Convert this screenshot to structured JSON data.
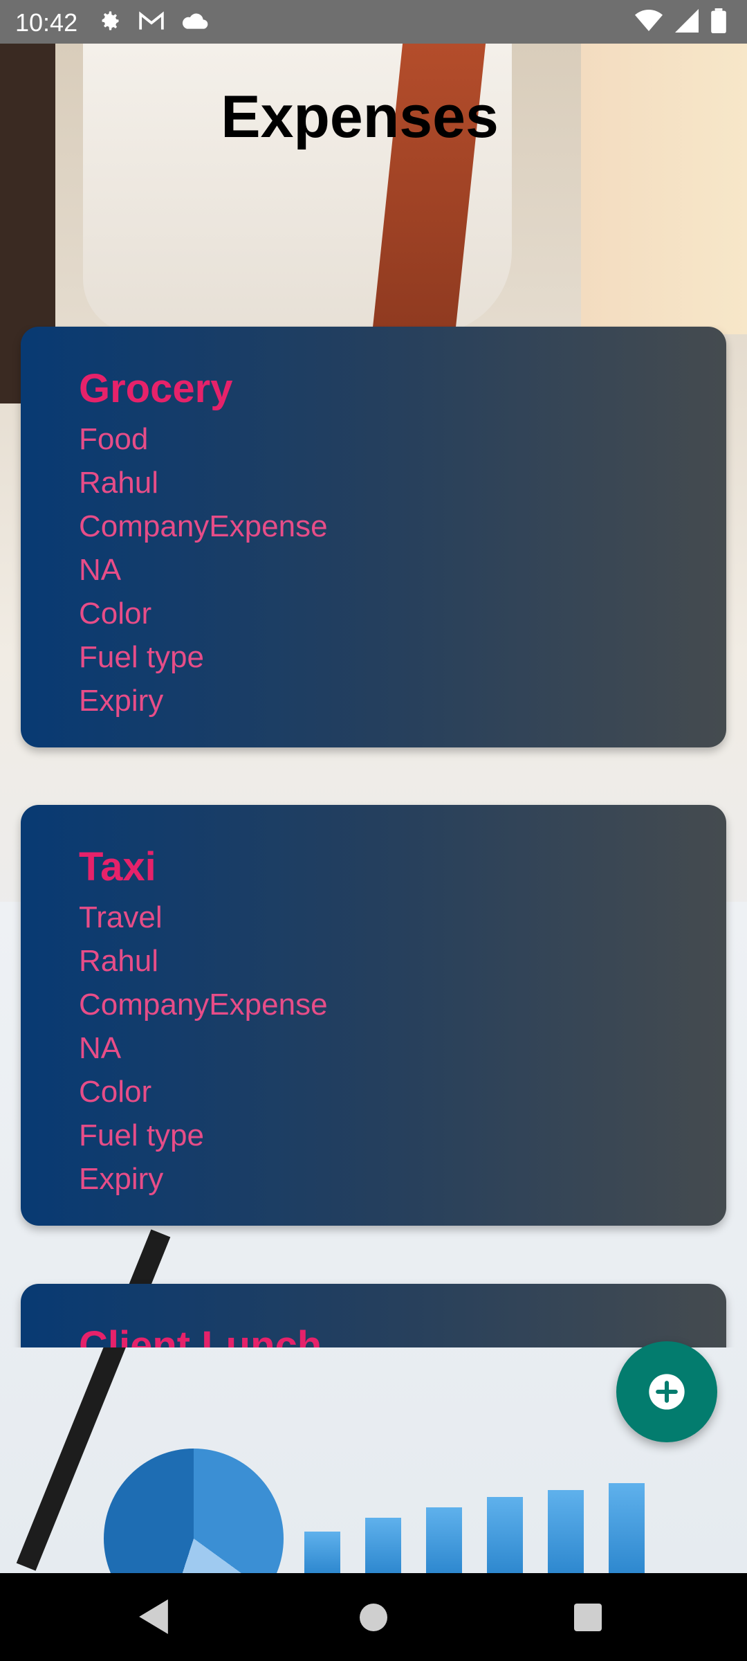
{
  "status_bar": {
    "time": "10:42",
    "left_icons": [
      "gear-icon",
      "gmail-icon",
      "cloud-icon"
    ],
    "right_icons": [
      "wifi-icon",
      "signal-icon",
      "battery-icon"
    ]
  },
  "screen": {
    "title": "Expenses"
  },
  "expenses": [
    {
      "title": "Grocery",
      "lines": [
        "Food",
        "Rahul",
        "CompanyExpense",
        "NA",
        "Color",
        "Fuel type",
        "Expiry"
      ]
    },
    {
      "title": "Taxi",
      "lines": [
        "Travel",
        "Rahul",
        "CompanyExpense",
        "NA",
        "Color",
        "Fuel type",
        "Expiry"
      ]
    },
    {
      "title": "Client Lunch",
      "lines": []
    }
  ],
  "fab": {
    "icon": "add-icon"
  },
  "colors": {
    "card_title": "#e6226a",
    "card_text": "#e74d88",
    "fab": "#037c6e"
  }
}
